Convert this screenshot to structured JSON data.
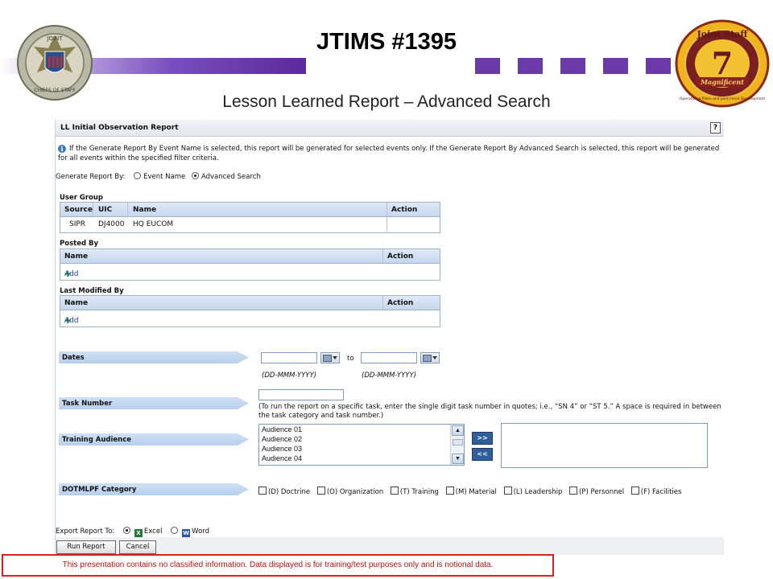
{
  "slide": {
    "title": "JTIMS #1395",
    "subtitle": "Lesson Learned Report – Advanced Search",
    "disclaimer": "This presentation contains no classified information. Data displayed is for training/test purposes only and is notional data.",
    "left_seal": {
      "top": "JOINT",
      "bottom": "CHIEFS OF STAFF"
    },
    "right_seal": {
      "top": "Joint Staff",
      "number": "7",
      "banner": "Magnificent",
      "ring": "Operational Plans and Joint Force Development"
    },
    "accent_purple": "#6a3aa8"
  },
  "report": {
    "title": "LL Initial Observation Report",
    "help": "?",
    "info_icon": "i",
    "info_text": "If the Generate Report By Event Name is selected, this report will be generated for selected events only. If the Generate Report By Advanced Search is selected, this report will be generated for all events within the specified filter criteria.",
    "generate_by_label": "Generate Report By:",
    "generate_options": [
      "Event Name",
      "Advanced Search"
    ],
    "generate_selected": "Advanced Search",
    "user_group": {
      "label": "User Group",
      "columns": [
        "Source",
        "UIC",
        "Name",
        "Action"
      ],
      "rows": [
        [
          "SIPR",
          "DJ4000",
          "HQ EUCOM",
          ""
        ]
      ]
    },
    "posted_by": {
      "label": "Posted By",
      "columns": [
        "Name",
        "Action"
      ],
      "add": "Add"
    },
    "last_modified_by": {
      "label": "Last Modified By",
      "columns": [
        "Name",
        "Action"
      ],
      "add": "Add"
    },
    "dates": {
      "label": "Dates",
      "from": "",
      "to_label": "to",
      "to": "",
      "format_hint": "(DD-MMM-YYYY)"
    },
    "task_number": {
      "label": "Task Number",
      "value": "",
      "hint": "(To run the report on a specific task, enter the single digit task number in quotes; i.e., “SN 4” or “ST 5.” A space is required in between the task category and task number.)"
    },
    "training_audience": {
      "label": "Training Audience",
      "available": [
        "Audience 01",
        "Audience 02",
        "Audience 03",
        "Audience 04"
      ],
      "selected": [],
      "add_btn": ">>",
      "remove_btn": "<<"
    },
    "dotmlpf": {
      "label": "DOTMLPF Category",
      "options": [
        "(D) Doctrine",
        "(O) Organization",
        "(T) Training",
        "(M) Material",
        "(L) Leadership",
        "(P) Personnel",
        "(F) Facilities"
      ]
    },
    "export": {
      "label": "Export Report To:",
      "options": [
        "Excel",
        "Word"
      ],
      "selected": "Excel"
    },
    "buttons": {
      "run": "Run Report",
      "cancel": "Cancel"
    }
  }
}
